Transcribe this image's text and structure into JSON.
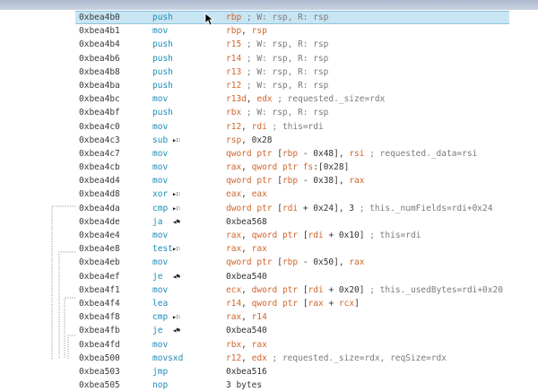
{
  "rows": [
    {
      "addr": "0xbea4b0",
      "mn": "push",
      "flag": "",
      "sel": true,
      "ops": [
        [
          "reg",
          "rbp"
        ],
        [
          "cm",
          " ; W: rsp, R: rsp"
        ]
      ]
    },
    {
      "addr": "0xbea4b1",
      "mn": "mov",
      "flag": "",
      "ops": [
        [
          "reg",
          "rbp"
        ],
        [
          "kw",
          ", "
        ],
        [
          "reg",
          "rsp"
        ]
      ]
    },
    {
      "addr": "0xbea4b4",
      "mn": "push",
      "flag": "",
      "ops": [
        [
          "reg",
          "r15"
        ],
        [
          "cm",
          " ; W: rsp, R: rsp"
        ]
      ]
    },
    {
      "addr": "0xbea4b6",
      "mn": "push",
      "flag": "",
      "ops": [
        [
          "reg",
          "r14"
        ],
        [
          "cm",
          " ; W: rsp, R: rsp"
        ]
      ]
    },
    {
      "addr": "0xbea4b8",
      "mn": "push",
      "flag": "",
      "ops": [
        [
          "reg",
          "r13"
        ],
        [
          "cm",
          " ; W: rsp, R: rsp"
        ]
      ]
    },
    {
      "addr": "0xbea4ba",
      "mn": "push",
      "flag": "",
      "ops": [
        [
          "reg",
          "r12"
        ],
        [
          "cm",
          " ; W: rsp, R: rsp"
        ]
      ]
    },
    {
      "addr": "0xbea4bc",
      "mn": "mov",
      "flag": "",
      "ops": [
        [
          "reg",
          "r13d"
        ],
        [
          "kw",
          ", "
        ],
        [
          "reg",
          "edx"
        ],
        [
          "cm",
          " ; requested._size=rdx"
        ]
      ]
    },
    {
      "addr": "0xbea4bf",
      "mn": "push",
      "flag": "",
      "ops": [
        [
          "reg",
          "rbx"
        ],
        [
          "cm",
          " ; W: rsp, R: rsp"
        ]
      ]
    },
    {
      "addr": "0xbea4c0",
      "mn": "mov",
      "flag": "",
      "ops": [
        [
          "reg",
          "r12"
        ],
        [
          "kw",
          ", "
        ],
        [
          "reg",
          "rdi"
        ],
        [
          "cm",
          " ; this=rdi"
        ]
      ]
    },
    {
      "addr": "0xbea4c3",
      "mn": "sub",
      "flag": "▸⚐",
      "ops": [
        [
          "reg",
          "rsp"
        ],
        [
          "kw",
          ", 0x28"
        ]
      ]
    },
    {
      "addr": "0xbea4c7",
      "mn": "mov",
      "flag": "",
      "ops": [
        [
          "reg",
          "qword ptr"
        ],
        [
          "kw",
          " ["
        ],
        [
          "reg",
          "rbp"
        ],
        [
          "kw",
          " - 0x48], "
        ],
        [
          "reg",
          "rsi"
        ],
        [
          "cm",
          " ; requested._data=rsi"
        ]
      ]
    },
    {
      "addr": "0xbea4cb",
      "mn": "mov",
      "flag": "",
      "ops": [
        [
          "reg",
          "rax"
        ],
        [
          "kw",
          ", "
        ],
        [
          "reg",
          "qword ptr fs"
        ],
        [
          "kw",
          ":[0x28]"
        ]
      ]
    },
    {
      "addr": "0xbea4d4",
      "mn": "mov",
      "flag": "",
      "ops": [
        [
          "reg",
          "qword ptr"
        ],
        [
          "kw",
          " ["
        ],
        [
          "reg",
          "rbp"
        ],
        [
          "kw",
          " - 0x38], "
        ],
        [
          "reg",
          "rax"
        ]
      ]
    },
    {
      "addr": "0xbea4d8",
      "mn": "xor",
      "flag": "▸⚐",
      "ops": [
        [
          "reg",
          "eax"
        ],
        [
          "kw",
          ", "
        ],
        [
          "reg",
          "eax"
        ]
      ]
    },
    {
      "addr": "0xbea4da",
      "mn": "cmp",
      "flag": "▸⚐",
      "ops": [
        [
          "reg",
          "dword ptr"
        ],
        [
          "kw",
          " ["
        ],
        [
          "reg",
          "rdi"
        ],
        [
          "kw",
          " + 0x24], 3"
        ],
        [
          "cm",
          " ; this._numFields=rdi+0x24"
        ]
      ]
    },
    {
      "addr": "0xbea4de",
      "mn": "ja",
      "flag": "◂⚑",
      "ops": [
        [
          "kw",
          "0xbea568"
        ]
      ]
    },
    {
      "addr": "0xbea4e4",
      "mn": "mov",
      "flag": "",
      "ops": [
        [
          "reg",
          "rax"
        ],
        [
          "kw",
          ", "
        ],
        [
          "reg",
          "qword ptr"
        ],
        [
          "kw",
          " ["
        ],
        [
          "reg",
          "rdi"
        ],
        [
          "kw",
          " + 0x10]"
        ],
        [
          "cm",
          " ; this=rdi"
        ]
      ]
    },
    {
      "addr": "0xbea4e8",
      "mn": "test",
      "flag": "▸⚐",
      "ops": [
        [
          "reg",
          "rax"
        ],
        [
          "kw",
          ", "
        ],
        [
          "reg",
          "rax"
        ]
      ]
    },
    {
      "addr": "0xbea4eb",
      "mn": "mov",
      "flag": "",
      "ops": [
        [
          "reg",
          "qword ptr"
        ],
        [
          "kw",
          " ["
        ],
        [
          "reg",
          "rbp"
        ],
        [
          "kw",
          " - 0x50], "
        ],
        [
          "reg",
          "rax"
        ]
      ]
    },
    {
      "addr": "0xbea4ef",
      "mn": "je",
      "flag": "◂⚑",
      "ops": [
        [
          "kw",
          "0xbea540"
        ]
      ]
    },
    {
      "addr": "0xbea4f1",
      "mn": "mov",
      "flag": "",
      "ops": [
        [
          "reg",
          "ecx"
        ],
        [
          "kw",
          ", "
        ],
        [
          "reg",
          "dword ptr"
        ],
        [
          "kw",
          " ["
        ],
        [
          "reg",
          "rdi"
        ],
        [
          "kw",
          " + 0x20]"
        ],
        [
          "cm",
          " ; this._usedBytes=rdi+0x20"
        ]
      ]
    },
    {
      "addr": "0xbea4f4",
      "mn": "lea",
      "flag": "",
      "ops": [
        [
          "reg",
          "r14"
        ],
        [
          "kw",
          ", "
        ],
        [
          "reg",
          "qword ptr"
        ],
        [
          "kw",
          " ["
        ],
        [
          "reg",
          "rax"
        ],
        [
          "kw",
          " + "
        ],
        [
          "reg",
          "rcx"
        ],
        [
          "kw",
          "]"
        ]
      ]
    },
    {
      "addr": "0xbea4f8",
      "mn": "cmp",
      "flag": "▸⚐",
      "ops": [
        [
          "reg",
          "rax"
        ],
        [
          "kw",
          ", "
        ],
        [
          "reg",
          "r14"
        ]
      ]
    },
    {
      "addr": "0xbea4fb",
      "mn": "je",
      "flag": "◂⚑",
      "ops": [
        [
          "kw",
          "0xbea540"
        ]
      ]
    },
    {
      "addr": "0xbea4fd",
      "mn": "mov",
      "flag": "",
      "ops": [
        [
          "reg",
          "rbx"
        ],
        [
          "kw",
          ", "
        ],
        [
          "reg",
          "rax"
        ]
      ]
    },
    {
      "addr": "0xbea500",
      "mn": "movsxd",
      "flag": "",
      "ops": [
        [
          "reg",
          "r12"
        ],
        [
          "kw",
          ", "
        ],
        [
          "reg",
          "edx"
        ],
        [
          "cm",
          " ; requested._size=rdx, reqSize=rdx"
        ]
      ]
    },
    {
      "addr": "0xbea503",
      "mn": "jmp",
      "flag": "",
      "ops": [
        [
          "kw",
          "0xbea516"
        ]
      ]
    },
    {
      "addr": "0xbea505",
      "mn": "nop",
      "flag": "",
      "ops": [
        [
          "kw",
          "3 bytes"
        ]
      ]
    }
  ]
}
